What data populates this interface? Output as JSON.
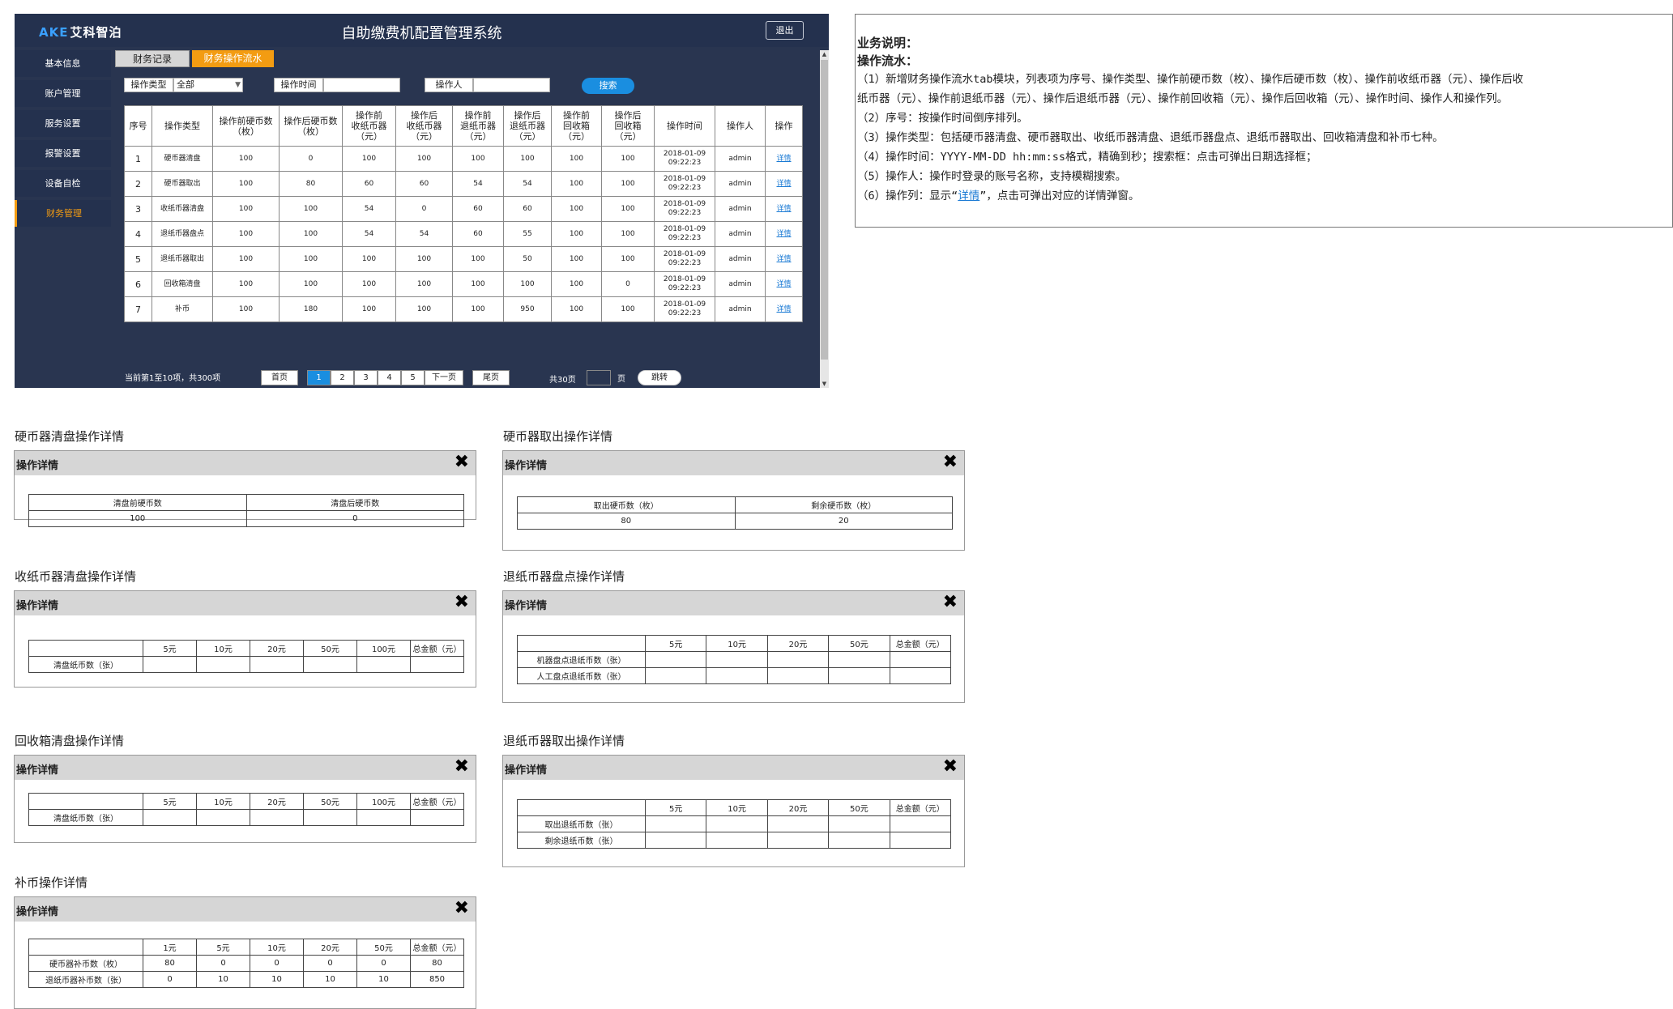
{
  "app": {
    "logo_brand": "AKE",
    "logo_name": "艾科智泊",
    "title": "自助缴费机配置管理系统",
    "logout": "退出"
  },
  "sidebar": {
    "items": [
      "基本信息",
      "账户管理",
      "服务设置",
      "报警设置",
      "设备自检",
      "财务管理"
    ],
    "active": 5
  },
  "tabs": [
    "财务记录",
    "财务操作流水"
  ],
  "filters": {
    "type_label": "操作类型",
    "type_value": "全部",
    "time_label": "操作时间",
    "time_value": "",
    "operator_label": "操作人",
    "operator_value": "",
    "search": "搜索"
  },
  "table": {
    "headers": [
      [
        "序号"
      ],
      [
        "操作类型"
      ],
      [
        "操作前硬币数",
        "（枚）"
      ],
      [
        "操作后硬币数",
        "（枚）"
      ],
      [
        "操作前",
        "收纸币器",
        "（元）"
      ],
      [
        "操作后",
        "收纸币器",
        "（元）"
      ],
      [
        "操作前",
        "退纸币器",
        "（元）"
      ],
      [
        "操作后",
        "退纸币器",
        "（元）"
      ],
      [
        "操作前",
        "回收箱",
        "（元）"
      ],
      [
        "操作后",
        "回收箱",
        "（元）"
      ],
      [
        "操作时间"
      ],
      [
        "操作人"
      ],
      [
        "操作"
      ]
    ],
    "rows": [
      {
        "seq": "1",
        "type": "硬币器清盘",
        "c1": "100",
        "c2": "0",
        "c3": "100",
        "c4": "100",
        "c5": "100",
        "c6": "100",
        "c7": "100",
        "c8": "100",
        "date": "2018-01-09",
        "time": "09:22:23",
        "op": "admin",
        "action": "详情"
      },
      {
        "seq": "2",
        "type": "硬币器取出",
        "c1": "100",
        "c2": "80",
        "c3": "60",
        "c4": "60",
        "c5": "54",
        "c6": "54",
        "c7": "100",
        "c8": "100",
        "date": "2018-01-09",
        "time": "09:22:23",
        "op": "admin",
        "action": "详情"
      },
      {
        "seq": "3",
        "type": "收纸币器清盘",
        "c1": "100",
        "c2": "100",
        "c3": "54",
        "c4": "0",
        "c5": "60",
        "c6": "60",
        "c7": "100",
        "c8": "100",
        "date": "2018-01-09",
        "time": "09:22:23",
        "op": "admin",
        "action": "详情"
      },
      {
        "seq": "4",
        "type": "退纸币器盘点",
        "c1": "100",
        "c2": "100",
        "c3": "54",
        "c4": "54",
        "c5": "60",
        "c6": "55",
        "c7": "100",
        "c8": "100",
        "date": "2018-01-09",
        "time": "09:22:23",
        "op": "admin",
        "action": "详情"
      },
      {
        "seq": "5",
        "type": "退纸币器取出",
        "c1": "100",
        "c2": "100",
        "c3": "100",
        "c4": "100",
        "c5": "100",
        "c6": "50",
        "c7": "100",
        "c8": "100",
        "date": "2018-01-09",
        "time": "09:22:23",
        "op": "admin",
        "action": "详情"
      },
      {
        "seq": "6",
        "type": "回收箱清盘",
        "c1": "100",
        "c2": "100",
        "c3": "100",
        "c4": "100",
        "c5": "100",
        "c6": "100",
        "c7": "100",
        "c8": "0",
        "date": "2018-01-09",
        "time": "09:22:23",
        "op": "admin",
        "action": "详情"
      },
      {
        "seq": "7",
        "type": "补币",
        "c1": "100",
        "c2": "180",
        "c3": "100",
        "c4": "100",
        "c5": "100",
        "c6": "950",
        "c7": "100",
        "c8": "100",
        "date": "2018-01-09",
        "time": "09:22:23",
        "op": "admin",
        "action": "详情"
      }
    ]
  },
  "pagination": {
    "info": "当前第1至10项，共300项",
    "first": "首页",
    "pages": [
      "1",
      "2",
      "3",
      "4",
      "5"
    ],
    "current": "1",
    "next": "下一页",
    "last": "尾页",
    "total": "共30页",
    "page_unit": "页",
    "jump": "跳转"
  },
  "notes": {
    "title": "业务说明：",
    "subtitle": "操作流水：",
    "lines": [
      "（1）新增财务操作流水tab模块，列表项为序号、操作类型、操作前硬币数（枚）、操作后硬币数（枚）、操作前收纸币器（元）、操作后收",
      "纸币器（元）、操作前退纸币器（元）、操作后退纸币器（元）、操作前回收箱（元）、操作后回收箱（元）、操作时间、操作人和操作列。",
      "（2）序号：按操作时间倒序排列。",
      "（3）操作类型：包括硬币器清盘、硬币器取出、收纸币器清盘、退纸币器盘点、退纸币器取出、回收箱清盘和补币七种。",
      "（4）操作时间：YYYY-MM-DD hh:mm:ss格式，精确到秒；搜索框：点击可弹出日期选择框；",
      "（5）操作人：操作时登录的账号名称，支持模糊搜索。"
    ],
    "line6_pre": "（6）操作列：显示“",
    "line6_link": "详情",
    "line6_post": "”，点击可弹出对应的详情弹窗。"
  },
  "dialogs": {
    "header": "操作详情",
    "coin_clear": {
      "title": "硬币器清盘操作详情",
      "rows": [
        [
          "清盘前硬币数",
          "清盘后硬币数"
        ],
        [
          "100",
          "0"
        ]
      ]
    },
    "coin_take": {
      "title": "硬币器取出操作详情",
      "rows": [
        [
          "取出硬币数（枚）",
          "剩余硬币数（枚）"
        ],
        [
          "80",
          "20"
        ]
      ]
    },
    "note_clear": {
      "title": "收纸币器清盘操作详情",
      "rows": [
        [
          "",
          "5元",
          "10元",
          "20元",
          "50元",
          "100元",
          "总金额（元）"
        ],
        [
          "清盘纸币数（张）",
          "",
          "",
          "",
          "",
          "",
          ""
        ]
      ]
    },
    "refund_count": {
      "title": "退纸币器盘点操作详情",
      "rows": [
        [
          "",
          "5元",
          "10元",
          "20元",
          "50元",
          "总金额（元）"
        ],
        [
          "机器盘点退纸币数（张）",
          "",
          "",
          "",
          "",
          ""
        ],
        [
          "人工盘点退纸币数（张）",
          "",
          "",
          "",
          "",
          ""
        ]
      ]
    },
    "box_clear": {
      "title": "回收箱清盘操作详情",
      "rows": [
        [
          "",
          "5元",
          "10元",
          "20元",
          "50元",
          "100元",
          "总金额（元）"
        ],
        [
          "清盘纸币数（张）",
          "",
          "",
          "",
          "",
          "",
          ""
        ]
      ]
    },
    "refund_take": {
      "title": "退纸币器取出操作详情",
      "rows": [
        [
          "",
          "5元",
          "10元",
          "20元",
          "50元",
          "总金额（元）"
        ],
        [
          "取出退纸币数（张）",
          "",
          "",
          "",
          "",
          ""
        ],
        [
          "剩余退纸币数（张）",
          "",
          "",
          "",
          "",
          ""
        ]
      ]
    },
    "refill": {
      "title": "补币操作详情",
      "rows": [
        [
          "",
          "1元",
          "5元",
          "10元",
          "20元",
          "50元",
          "总金额（元）"
        ],
        [
          "硬币器补币数（枚）",
          "80",
          "0",
          "0",
          "0",
          "0",
          "80"
        ],
        [
          "退纸币器补币数（张）",
          "0",
          "10",
          "10",
          "10",
          "10",
          "850"
        ]
      ]
    }
  }
}
